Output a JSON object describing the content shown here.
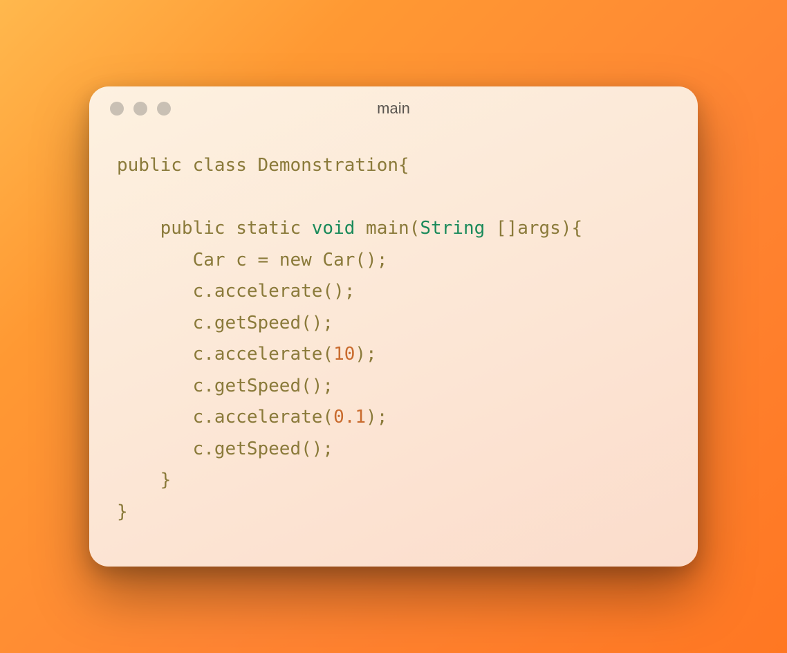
{
  "window": {
    "title": "main"
  },
  "code": {
    "tokens": [
      {
        "t": "public",
        "c": "kw-olive"
      },
      {
        "t": " "
      },
      {
        "t": "class",
        "c": "kw-olive"
      },
      {
        "t": " Demonstration{"
      },
      {
        "t": "\n"
      },
      {
        "t": "\n"
      },
      {
        "t": "    "
      },
      {
        "t": "public",
        "c": "kw-olive"
      },
      {
        "t": " "
      },
      {
        "t": "static",
        "c": "kw-olive"
      },
      {
        "t": " "
      },
      {
        "t": "void",
        "c": "kw-green"
      },
      {
        "t": " main("
      },
      {
        "t": "String",
        "c": "kw-green"
      },
      {
        "t": " []args){"
      },
      {
        "t": "\n"
      },
      {
        "t": "       Car c = "
      },
      {
        "t": "new",
        "c": "kw-olive"
      },
      {
        "t": " Car();"
      },
      {
        "t": "\n"
      },
      {
        "t": "       c.accelerate();"
      },
      {
        "t": "\n"
      },
      {
        "t": "       c.getSpeed();"
      },
      {
        "t": "\n"
      },
      {
        "t": "       c.accelerate("
      },
      {
        "t": "10",
        "c": "num"
      },
      {
        "t": ");"
      },
      {
        "t": "\n"
      },
      {
        "t": "       c.getSpeed();"
      },
      {
        "t": "\n"
      },
      {
        "t": "       c.accelerate("
      },
      {
        "t": "0.1",
        "c": "num"
      },
      {
        "t": ");"
      },
      {
        "t": "\n"
      },
      {
        "t": "       c.getSpeed();"
      },
      {
        "t": "\n"
      },
      {
        "t": "    }"
      },
      {
        "t": "\n"
      },
      {
        "t": "}"
      }
    ]
  }
}
